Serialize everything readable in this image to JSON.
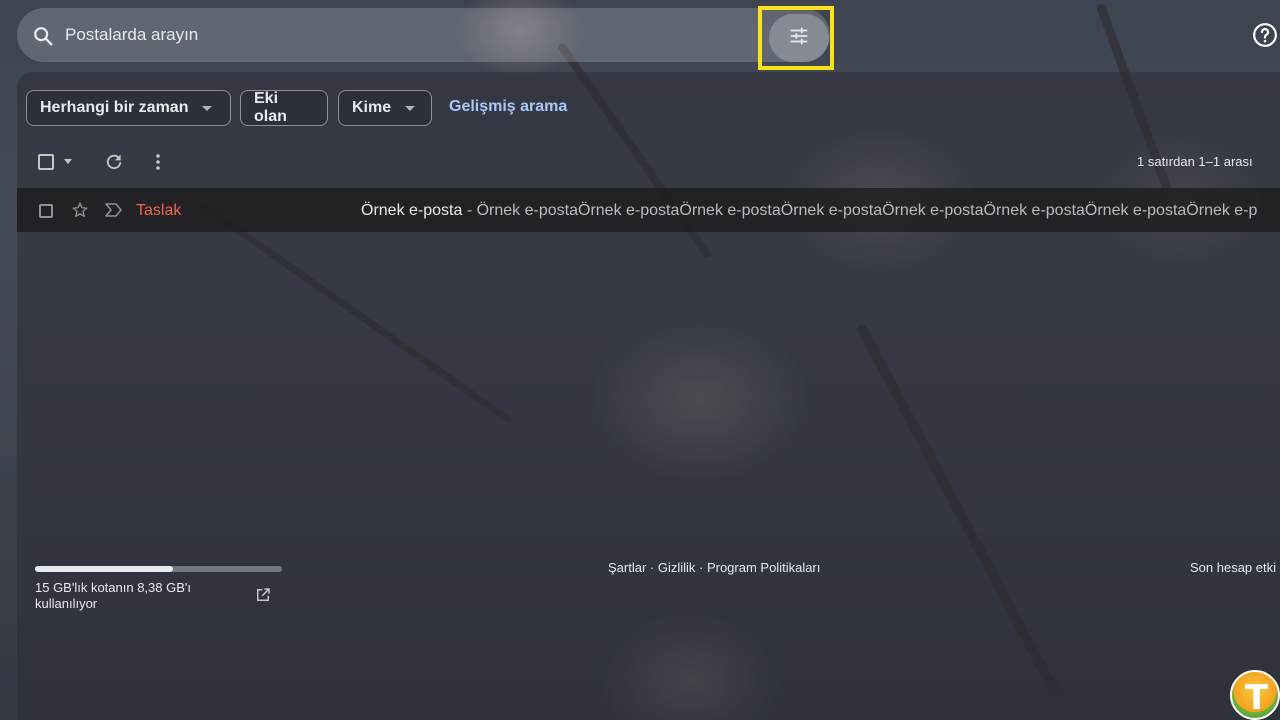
{
  "search": {
    "placeholder": "Postalarda arayın",
    "icon": "search-icon",
    "filter_icon": "tune-icon",
    "help_icon": "help-icon",
    "highlight_color": "#f7e318"
  },
  "filters": {
    "time_chip": "Herhangi bir zaman",
    "attachment_chip": "Eki olan",
    "to_chip": "Kime",
    "advanced_link": "Gelişmiş arama"
  },
  "toolbar": {
    "pager_text": "1 satırdan 1–1 arası"
  },
  "emails": [
    {
      "sender": "Taslak",
      "subject": "Örnek e-posta",
      "snippet": " - Örnek e-postaÖrnek e-postaÖrnek e-postaÖrnek e-postaÖrnek e-postaÖrnek e-postaÖrnek e-postaÖrnek e-p"
    }
  ],
  "storage": {
    "text": "15 GB'lık kotanın 8,38 GB'ı kullanılıyor",
    "used_fraction": 0.56
  },
  "footer": {
    "links": "Şartlar · Gizlilik · Program Politikaları",
    "last_activity": "Son hesap etki"
  },
  "colors": {
    "draft_sender": "#f2634a",
    "link": "#a8c7fa"
  },
  "logo": {
    "letter": "T"
  }
}
